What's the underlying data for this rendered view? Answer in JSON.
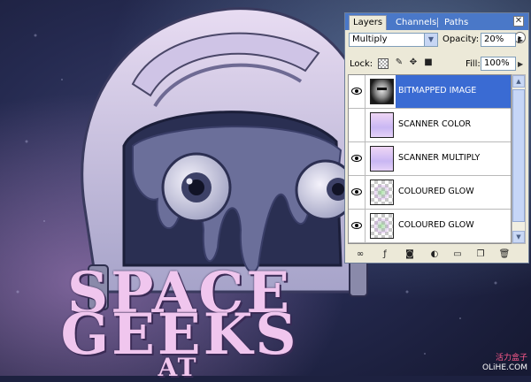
{
  "artwork": {
    "poster_lines": [
      "SPACE",
      "GEEKS",
      "AT"
    ],
    "watermark_line1": "活力盒子",
    "watermark_line2": "OLiHE.COM"
  },
  "layers_panel": {
    "tabs": [
      {
        "label": "Layers",
        "active": true
      },
      {
        "label": "Channels",
        "active": false
      },
      {
        "label": "Paths",
        "active": false
      }
    ],
    "close_glyph": "✕",
    "menu_glyph": "▸",
    "blend_mode": "Multiply",
    "opacity_label": "Opacity:",
    "opacity_value": "20%",
    "lock_label": "Lock:",
    "fill_label": "Fill:",
    "fill_value": "100%",
    "layers": [
      {
        "name": "BITMAPPED IMAGE",
        "thumbnail": "head-bitmap-thumbnail",
        "visible": true,
        "selected": true
      },
      {
        "name": "SCANNER COLOR",
        "thumbnail": "lilac-fill-thumbnail",
        "visible": false,
        "selected": false
      },
      {
        "name": "SCANNER MULTIPLY",
        "thumbnail": "lilac-fill-thumbnail",
        "visible": true,
        "selected": false
      },
      {
        "name": "COLOURED GLOW",
        "thumbnail": "transparent-glow-thumbnail",
        "visible": true,
        "selected": false
      },
      {
        "name": "COLOURED GLOW",
        "thumbnail": "transparent-glow-thumbnail",
        "visible": true,
        "selected": false
      }
    ],
    "bottom_buttons": [
      {
        "icon": "link-icon",
        "glyph": "∞"
      },
      {
        "icon": "layer-style-icon",
        "glyph": "ƒ"
      },
      {
        "icon": "mask-icon",
        "glyph": "◙"
      },
      {
        "icon": "adjustment-icon",
        "glyph": "◐"
      },
      {
        "icon": "group-folder-icon",
        "glyph": "▭"
      },
      {
        "icon": "new-layer-icon",
        "glyph": "❐"
      },
      {
        "icon": "trash-icon",
        "glyph": "🗑"
      }
    ],
    "colors": {
      "titlebar": "#4a78c8",
      "selected_row": "#3a6bd3",
      "panel_bg": "#ece9d8"
    }
  }
}
